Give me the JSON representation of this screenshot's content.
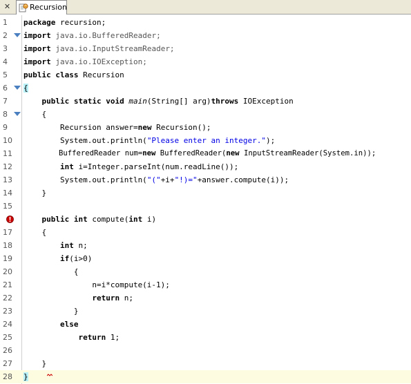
{
  "tab": {
    "close_glyph": "✕",
    "label": "Recursion",
    "icon": "java-source-file-icon"
  },
  "editor": {
    "line_numbers": [
      "1",
      "2",
      "3",
      "4",
      "5",
      "6",
      "7",
      "8",
      "9",
      "10",
      "11",
      "12",
      "13",
      "14",
      "15",
      "16",
      "17",
      "18",
      "19",
      "20",
      "21",
      "22",
      "23",
      "24",
      "25",
      "26",
      "27",
      "28"
    ],
    "error_line_marker": "error-badge-icon",
    "fold_marker": "fold-collapse-icon",
    "colors": {
      "keyword": "#000000",
      "string": "#0000e6",
      "import_path": "#555555",
      "current_line": "#fdfbe0",
      "brace_highlight": "#b8f0f8",
      "error": "#cc0000"
    },
    "code": {
      "l1": {
        "kw": "package",
        "rest": " recursion;"
      },
      "l2": {
        "kw": "import",
        "rest": " java.io.BufferedReader;"
      },
      "l3": {
        "kw": "import",
        "rest": " java.io.InputStreamReader;"
      },
      "l4": {
        "kw": "import",
        "rest": " java.io.IOException;"
      },
      "l5": {
        "kw1": "public",
        "kw2": " class",
        "rest": " Recursion"
      },
      "l6": {
        "brace": "{"
      },
      "l7": {
        "indent": "    ",
        "kw": "public static void",
        "method": " main",
        "args": "(String[] arg)",
        "kw2": "throws",
        "rest": " IOException"
      },
      "l8": {
        "text": "    {"
      },
      "l9": {
        "a": "        Recursion answer=",
        "kw": "new",
        "b": " Recursion();"
      },
      "l10": {
        "a": "        System.out.println(",
        "str": "\"Please enter an integer.\"",
        "b": ");"
      },
      "l11": {
        "a": "        BufferedReader num=",
        "kw": "new",
        "b": " BufferedReader(",
        "kw2": "new",
        "c": " InputStreamReader(System.in));"
      },
      "l12": {
        "indent": "        ",
        "kw": "int",
        "rest": " i=Integer.parseInt(num.readLine());"
      },
      "l13": {
        "a": "        System.out.println(",
        "s1": "\"(\"",
        "b": "+i+",
        "s2": "\"!)=\"",
        "c": "+answer.compute(i));"
      },
      "l14": {
        "text": "    }"
      },
      "l15": {
        "text": ""
      },
      "l16": {
        "indent": "    ",
        "kw": "public int",
        "b": " compute(",
        "kw2": "int",
        "c": " i)"
      },
      "l17": {
        "text": "    {"
      },
      "l18": {
        "indent": "        ",
        "kw": "int",
        "rest": " n;"
      },
      "l19": {
        "indent": "        ",
        "kw": "if",
        "rest": "(i>0)"
      },
      "l20": {
        "text": "           {"
      },
      "l21": {
        "text": "               n=i*compute(i-1);"
      },
      "l22": {
        "indent": "               ",
        "kw": "return",
        "rest": " n;"
      },
      "l23": {
        "text": "           }"
      },
      "l24": {
        "indent": "        ",
        "kw": "else",
        "rest": ""
      },
      "l25": {
        "indent": "            ",
        "kw": "return",
        "rest": " 1;"
      },
      "l26": {
        "text": ""
      },
      "l27": {
        "text": "    }"
      },
      "l28": {
        "brace": "}"
      }
    }
  }
}
